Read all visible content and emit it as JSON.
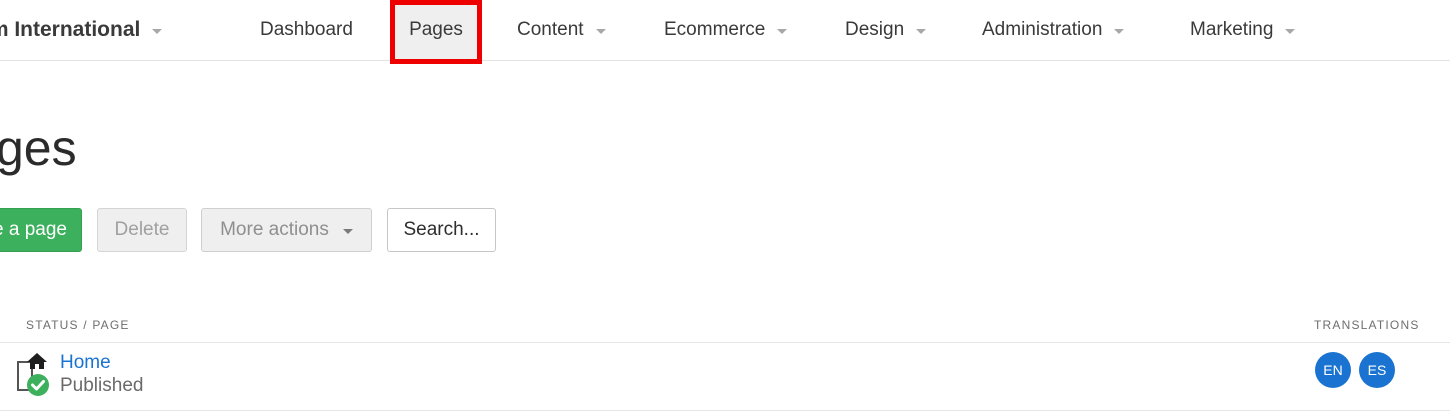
{
  "nav": {
    "brand": "tum International",
    "items": [
      {
        "label": "Dashboard"
      },
      {
        "label": "Pages"
      },
      {
        "label": "Content"
      },
      {
        "label": "Ecommerce"
      },
      {
        "label": "Design"
      },
      {
        "label": "Administration"
      },
      {
        "label": "Marketing"
      }
    ],
    "active": "Pages"
  },
  "page": {
    "title": "ges"
  },
  "toolbar": {
    "create_label": "e a page",
    "delete_label": "Delete",
    "more_label": "More actions",
    "search_label": "Search..."
  },
  "table": {
    "headers": {
      "status_page": "STATUS / PAGE",
      "translations": "TRANSLATIONS"
    },
    "rows": [
      {
        "name": "Home",
        "status": "Published",
        "translations": [
          "EN",
          "ES"
        ]
      }
    ]
  },
  "colors": {
    "accent_blue": "#1a73d0",
    "create_green": "#3cb05c",
    "highlight_red": "#ee0000",
    "published_green": "#3cb05c"
  },
  "icons": {
    "page_status": "home-page-published-icon",
    "dropdown": "caret-down-icon"
  }
}
